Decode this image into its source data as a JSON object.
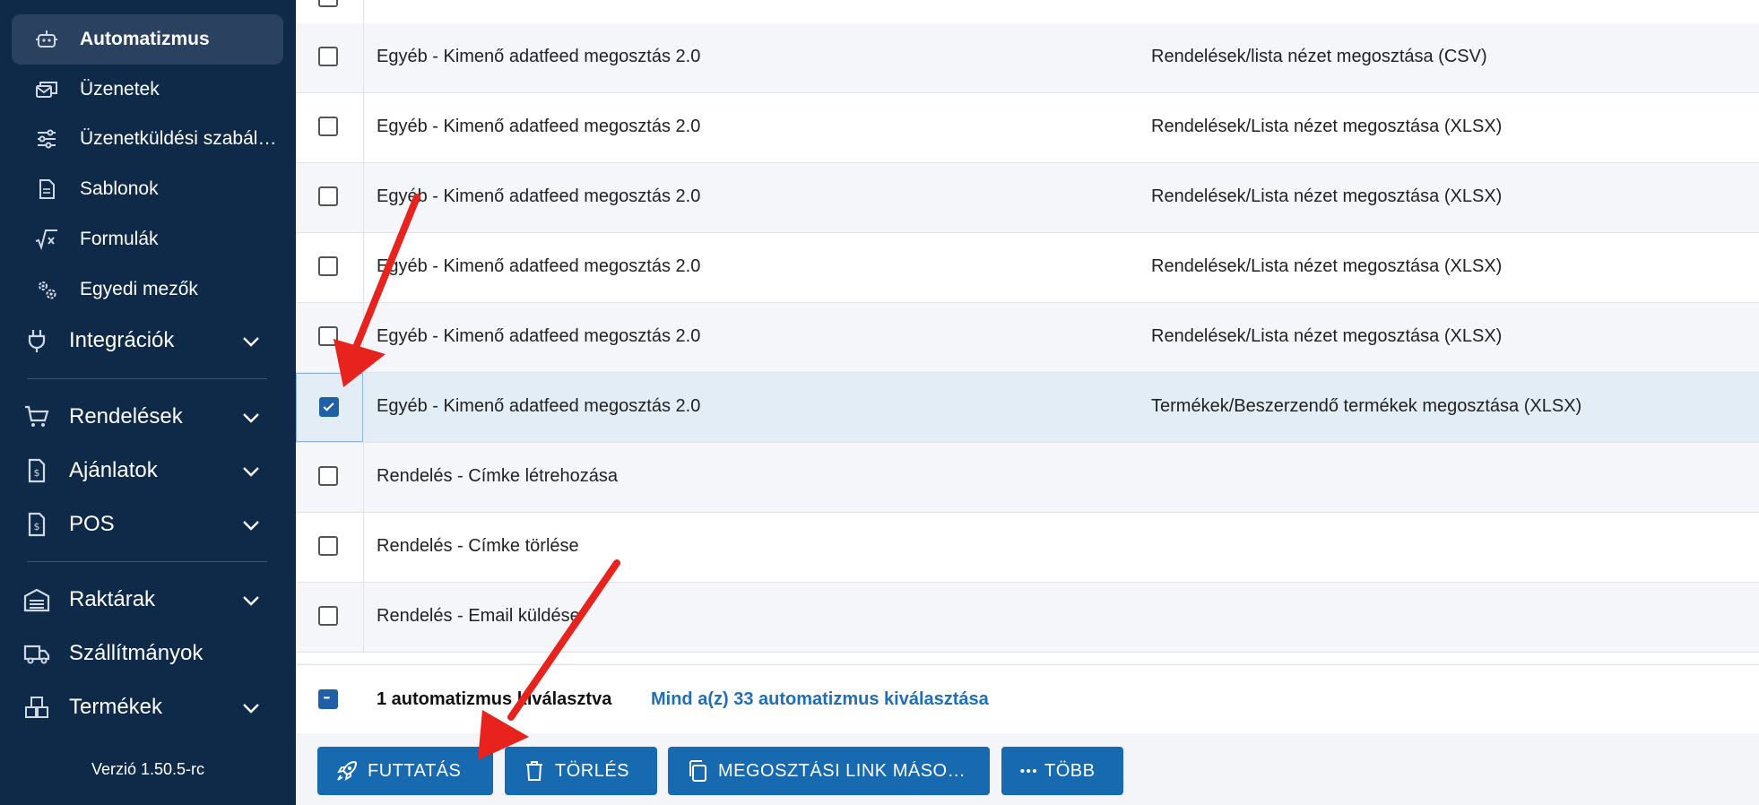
{
  "sidebar": {
    "sub_items": [
      {
        "label": "Automatizmus",
        "icon": "robot-icon"
      },
      {
        "label": "Üzenetek",
        "icon": "messages-icon"
      },
      {
        "label": "Üzenetküldési szabályok",
        "icon": "sliders-icon"
      },
      {
        "label": "Sablonok",
        "icon": "document-icon"
      },
      {
        "label": "Formulák",
        "icon": "formula-icon"
      },
      {
        "label": "Egyedi mezők",
        "icon": "gears-icon"
      }
    ],
    "main_items": [
      {
        "label": "Integrációk",
        "icon": "plug-icon"
      },
      {
        "label": "Rendelések",
        "icon": "cart-icon"
      },
      {
        "label": "Ajánlatok",
        "icon": "invoice-icon"
      },
      {
        "label": "POS",
        "icon": "pos-icon"
      },
      {
        "label": "Raktárak",
        "icon": "warehouse-icon"
      },
      {
        "label": "Szállítmányok",
        "icon": "truck-icon"
      },
      {
        "label": "Termékek",
        "icon": "boxes-icon"
      }
    ],
    "version": "Verzió 1.50.5-rc"
  },
  "table": {
    "rows": [
      {
        "name": "Egyéb - Kimenő adatfeed megosztás 2.0",
        "detail": "Rendelések/lista nézet megosztása (CSV)",
        "checked": false
      },
      {
        "name": "Egyéb - Kimenő adatfeed megosztás 2.0",
        "detail": "Rendelések/Lista nézet megosztása (XLSX)",
        "checked": false
      },
      {
        "name": "Egyéb - Kimenő adatfeed megosztás 2.0",
        "detail": "Rendelések/Lista nézet megosztása (XLSX)",
        "checked": false
      },
      {
        "name": "Egyéb - Kimenő adatfeed megosztás 2.0",
        "detail": "Rendelések/Lista nézet megosztása (XLSX)",
        "checked": false
      },
      {
        "name": "Egyéb - Kimenő adatfeed megosztás 2.0",
        "detail": "Rendelések/Lista nézet megosztása (XLSX)",
        "checked": false
      },
      {
        "name": "Egyéb - Kimenő adatfeed megosztás 2.0",
        "detail": "Termékek/Beszerzendő termékek megosztása (XLSX)",
        "checked": true
      },
      {
        "name": "Rendelés - Címke létrehozása",
        "detail": "",
        "checked": false
      },
      {
        "name": "Rendelés - Címke törlése",
        "detail": "",
        "checked": false
      },
      {
        "name": "Rendelés - Email küldése",
        "detail": "",
        "checked": false
      }
    ]
  },
  "selection": {
    "count_text": "1 automatizmus kiválasztva",
    "select_all_text": "Mind a(z) 33 automatizmus kiválasztása"
  },
  "actions": {
    "run": "FUTTATÁS",
    "delete": "TÖRLÉS",
    "copy_link": "MEGOSZTÁSI LINK MÁSOLÁSA",
    "more": "TÖBB"
  },
  "colors": {
    "sidebar_bg": "#0f2a48",
    "primary": "#1769b0",
    "annotation_arrow": "#e8231e"
  }
}
